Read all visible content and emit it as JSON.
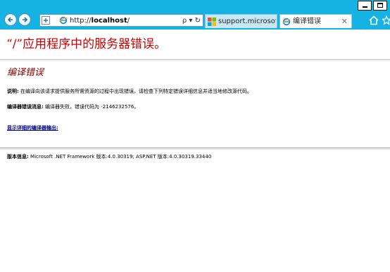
{
  "browser": {
    "address": {
      "scheme": "http://",
      "host": "localhost",
      "path": "/",
      "tools": "ρ ▾ ↻"
    },
    "tabs": [
      {
        "label": "support.microsoft..."
      },
      {
        "label": "编译错误",
        "close": "✕"
      }
    ],
    "colors": {
      "titlebar": "#15b2e4",
      "tab_inactive": "#c7e9f7"
    }
  },
  "page": {
    "title": "“/”应用程序中的服务器错误。",
    "subtitle": "编译错误",
    "description_label": "说明:",
    "description_text": " 在编译向该请求提供服务所需资源的过程中出现错误。请检查下列特定错误详细信息并适当地修改源代码。",
    "compiler_msg_label": "编译器错误消息:",
    "compiler_msg_text": " 编译器失败，错误代码为 -2146232576。",
    "detail_link": "显示详细的编译器输出:",
    "version_label": "版本信息:",
    "version_text": " Microsoft .NET Framework 版本:4.0.30319; ASP.NET 版本:4.0.30319.33440",
    "colors": {
      "title": "#cc0000",
      "subtitle": "#800000",
      "link": "#000080"
    }
  }
}
